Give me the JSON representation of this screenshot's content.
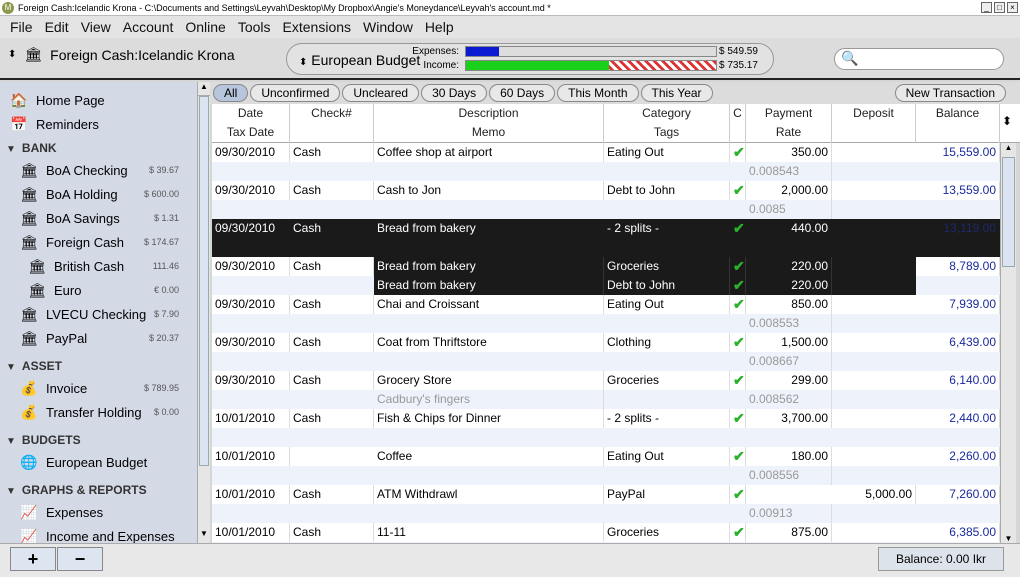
{
  "window": {
    "title": "Foreign Cash:Icelandic Krona - C:\\Documents and Settings\\Leyvah\\Desktop\\My Dropbox\\Angie's Moneydance\\Leyvah's account.md *"
  },
  "menu": [
    "File",
    "Edit",
    "View",
    "Account",
    "Online",
    "Tools",
    "Extensions",
    "Window",
    "Help"
  ],
  "toolbar": {
    "account": "Foreign Cash:Icelandic Krona",
    "budget": "European Budget",
    "expenses_label": "Expenses:",
    "income_label": "Income:",
    "expenses_amount": "$ 549.59",
    "income_amount": "$ 735.17",
    "expenses_fraction": 0.13,
    "income_fraction": 0.57,
    "search_placeholder": ""
  },
  "sidebar": {
    "top": [
      {
        "label": "Home Page",
        "icon": "house-icon"
      },
      {
        "label": "Reminders",
        "icon": "calendar-icon"
      }
    ],
    "sections": [
      {
        "title": "BANK",
        "items": [
          {
            "label": "BoA Checking",
            "balance": "$ 39.67"
          },
          {
            "label": "BoA Holding",
            "balance": "$ 600.00"
          },
          {
            "label": "BoA Savings",
            "balance": "$ 1.31"
          },
          {
            "label": "Foreign Cash",
            "balance": "$ 174.67"
          },
          {
            "label": "British Cash",
            "balance": "111.46",
            "sub": true
          },
          {
            "label": "Euro",
            "balance": "€ 0.00",
            "sub": true
          },
          {
            "label": "LVECU Checking",
            "balance": "$ 7.90"
          },
          {
            "label": "PayPal",
            "balance": "$ 20.37"
          }
        ]
      },
      {
        "title": "ASSET",
        "items": [
          {
            "label": "Invoice",
            "balance": "$ 789.95"
          },
          {
            "label": "Transfer Holding",
            "balance": "$ 0.00"
          }
        ]
      },
      {
        "title": "BUDGETS",
        "items": [
          {
            "label": "European Budget",
            "balance": ""
          }
        ]
      },
      {
        "title": "GRAPHS & REPORTS",
        "items": [
          {
            "label": "Expenses",
            "balance": ""
          },
          {
            "label": "Income and Expenses",
            "balance": ""
          }
        ]
      }
    ]
  },
  "filters": [
    "All",
    "Unconfirmed",
    "Uncleared",
    "30 Days",
    "60 Days",
    "This Month",
    "This Year"
  ],
  "filters_active": "All",
  "new_transaction": "New Transaction",
  "columns": [
    [
      "Date",
      "Tax Date"
    ],
    [
      "Check#",
      ""
    ],
    [
      "Description",
      "Memo"
    ],
    [
      "Category",
      "Tags"
    ],
    [
      "C",
      ""
    ],
    [
      "Payment",
      "Rate"
    ],
    [
      "Deposit",
      ""
    ],
    [
      "Balance",
      ""
    ]
  ],
  "transactions": [
    {
      "date": "09/30/2010",
      "check": "Cash",
      "desc": "Coffee shop at airport",
      "cat": "Eating Out",
      "c": "✔",
      "pay": "350.00",
      "dep": "",
      "bal": "15,559.00",
      "memo": "",
      "rate": "0.008543"
    },
    {
      "date": "09/30/2010",
      "check": "Cash",
      "desc": "Cash to Jon",
      "cat": "Debt to John",
      "c": "✔",
      "pay": "2,000.00",
      "dep": "",
      "bal": "13,559.00",
      "memo": "",
      "rate": "0.0085"
    },
    {
      "date": "09/30/2010",
      "check": "Cash",
      "desc": "Bread from bakery",
      "cat": "- 2 splits -",
      "c": "✔",
      "pay": "440.00",
      "dep": "",
      "bal": "13,119.00",
      "memo": "",
      "rate": "",
      "selected": true
    },
    {
      "date": "09/30/2010",
      "check": "Cash",
      "desc": "",
      "cat": "",
      "c": "",
      "pay": "",
      "dep": "",
      "bal": "8,789.00",
      "memo": "",
      "rate": "",
      "splits": [
        {
          "desc": "Bread from bakery",
          "cat": "Groceries",
          "c": "✔",
          "pay": "220.00"
        },
        {
          "desc": "Bread from bakery",
          "cat": "Debt to John",
          "c": "✔",
          "pay": "220.00"
        }
      ]
    },
    {
      "date": "09/30/2010",
      "check": "Cash",
      "desc": "Chai and Croissant",
      "cat": "Eating Out",
      "c": "✔",
      "pay": "850.00",
      "dep": "",
      "bal": "7,939.00",
      "memo": "",
      "rate": "0.008553"
    },
    {
      "date": "09/30/2010",
      "check": "Cash",
      "desc": "Coat from Thriftstore",
      "cat": "Clothing",
      "c": "✔",
      "pay": "1,500.00",
      "dep": "",
      "bal": "6,439.00",
      "memo": "",
      "rate": "0.008667"
    },
    {
      "date": "09/30/2010",
      "check": "Cash",
      "desc": "Grocery Store",
      "cat": "Groceries",
      "c": "✔",
      "pay": "299.00",
      "dep": "",
      "bal": "6,140.00",
      "memo": "Cadbury's fingers",
      "rate": "0.008562"
    },
    {
      "date": "10/01/2010",
      "check": "Cash",
      "desc": "Fish & Chips for Dinner",
      "cat": "- 2 splits -",
      "c": "✔",
      "pay": "3,700.00",
      "dep": "",
      "bal": "2,440.00",
      "memo": "",
      "rate": ""
    },
    {
      "date": "10/01/2010",
      "check": "",
      "desc": "Coffee",
      "cat": "Eating Out",
      "c": "✔",
      "pay": "180.00",
      "dep": "",
      "bal": "2,260.00",
      "memo": "",
      "rate": "0.008556"
    },
    {
      "date": "10/01/2010",
      "check": "Cash",
      "desc": "ATM Withdrawl",
      "cat": "PayPal",
      "c": "✔",
      "pay": "",
      "dep": "5,000.00",
      "bal": "7,260.00",
      "memo": "",
      "rate": "0.00913"
    },
    {
      "date": "10/01/2010",
      "check": "Cash",
      "desc": "11-11",
      "cat": "Groceries",
      "c": "✔",
      "pay": "875.00",
      "dep": "",
      "bal": "6,385.00",
      "memo": "",
      "rate": ""
    }
  ],
  "footer": {
    "add": "+",
    "remove": "−",
    "balance": "Balance: 0.00 Ikr"
  },
  "colors": {
    "selected_row": "#1a1a1a",
    "balance_text": "#1a2a9a",
    "check": "#2bb12b",
    "sidebar_bg": "#d4d9e6",
    "expenses_bar": "#0a1ad0",
    "income_bar": "#1ad01a"
  }
}
